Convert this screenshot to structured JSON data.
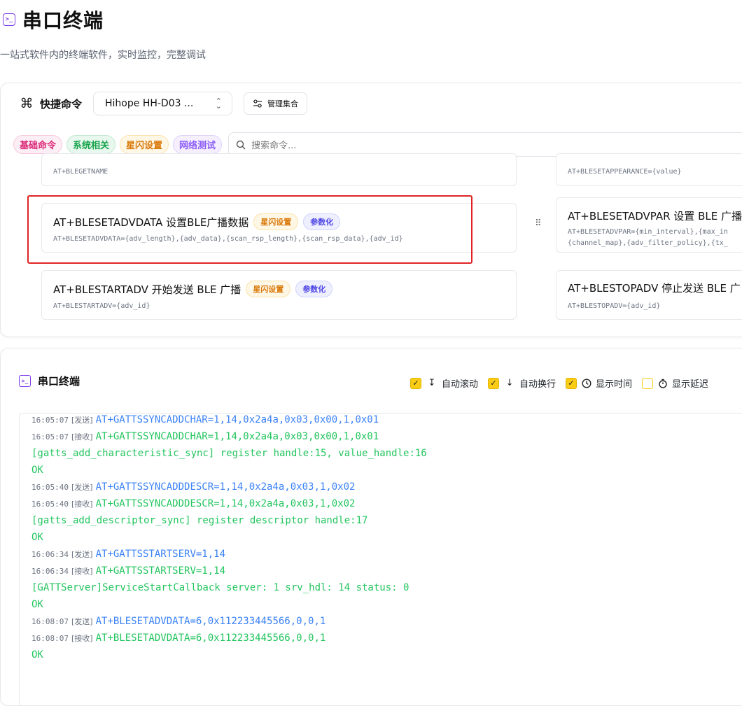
{
  "header": {
    "title": "串口终端",
    "subtitle": "一站式软件内的终端软件，实时监控，完整调试"
  },
  "commands": {
    "section_label": "快捷命令",
    "device": "Hihope HH-D03 ...",
    "manage_label": "管理集合",
    "tags": [
      "基础命令",
      "系统相关",
      "星闪设置",
      "网络测试"
    ],
    "search_placeholder": "搜索命令...",
    "cards": [
      {
        "title": "",
        "syntax": "AT+BLEGETNAME"
      },
      {
        "title": "",
        "syntax": "AT+BLESETAPPEARANCE={value}"
      },
      {
        "title": "AT+BLESETADVDATA 设置BLE广播数据",
        "badge1": "星闪设置",
        "badge2": "参数化",
        "syntax": "AT+BLESETADVDATA={adv_length},{adv_data},{scan_rsp_length},{scan_rsp_data},{adv_id}"
      },
      {
        "title": "AT+BLESETADVPAR 设置 BLE 广播",
        "syntax": "AT+BLESETADVPAR={min_interval},{max_in",
        "syntax2": "{channel_map},{adv_filter_policy},{tx_"
      },
      {
        "title": "AT+BLESTARTADV 开始发送 BLE 广播",
        "badge1": "星闪设置",
        "badge2": "参数化",
        "syntax": "AT+BLESTARTADV={adv_id}"
      },
      {
        "title": "AT+BLESTOPADV 停止发送 BLE 广",
        "syntax": "AT+BLESTOPADV={adv_id}"
      }
    ]
  },
  "terminal": {
    "title": "串口终端",
    "options": [
      {
        "label": "自动滚动",
        "checked": true,
        "icon": "auto-scroll-icon"
      },
      {
        "label": "自动换行",
        "checked": true,
        "icon": "arrow-down-icon"
      },
      {
        "label": "显示时间",
        "checked": true,
        "icon": "clock-icon"
      },
      {
        "label": "显示延迟",
        "checked": false,
        "icon": "timer-icon"
      }
    ],
    "lines": [
      {
        "ts": "16:05:07",
        "dir": "[发送]",
        "text": "AT+GATTSSYNCADDCHAR=1,14,0x2a4a,0x03,0x00,1,0x01"
      },
      {
        "ts": "16:05:07",
        "dir": "[接收]",
        "text": "AT+GATTSSYNCADDCHAR=1,14,0x2a4a,0x03,0x00,1,0x01"
      },
      {
        "ts": "",
        "dir": "",
        "text": "[gatts_add_characteristic_sync] register handle:15, value_handle:16"
      },
      {
        "ts": "",
        "dir": "",
        "text": "OK"
      },
      {
        "ts": "16:05:40",
        "dir": "[发送]",
        "text": "AT+GATTSSYNCADDDESCR=1,14,0x2a4a,0x03,1,0x02"
      },
      {
        "ts": "16:05:40",
        "dir": "[接收]",
        "text": "AT+GATTSSYNCADDDESCR=1,14,0x2a4a,0x03,1,0x02"
      },
      {
        "ts": "",
        "dir": "",
        "text": "[gatts_add_descriptor_sync] register descriptor handle:17"
      },
      {
        "ts": "",
        "dir": "",
        "text": "OK"
      },
      {
        "ts": "16:06:34",
        "dir": "[发送]",
        "text": "AT+GATTSSTARTSERV=1,14"
      },
      {
        "ts": "16:06:34",
        "dir": "[接收]",
        "text": "AT+GATTSSTARTSERV=1,14"
      },
      {
        "ts": "",
        "dir": "",
        "text": "[GATTServer]ServiceStartCallback server: 1 srv_hdl: 14 status: 0"
      },
      {
        "ts": "",
        "dir": "",
        "text": "OK"
      },
      {
        "ts": "16:08:07",
        "dir": "[发送]",
        "text": "AT+BLESETADVDATA=6,0x112233445566,0,0,1"
      },
      {
        "ts": "16:08:07",
        "dir": "[接收]",
        "text": "AT+BLESETADVDATA=6,0x112233445566,0,0,1"
      },
      {
        "ts": "",
        "dir": "",
        "text": "OK"
      }
    ]
  },
  "colors": {
    "accent_purple": "#7c3aed",
    "send_blue": "#3b82f6",
    "recv_green": "#22c55e",
    "checkbox_yellow": "#facc15",
    "highlight_red": "#e02424"
  }
}
